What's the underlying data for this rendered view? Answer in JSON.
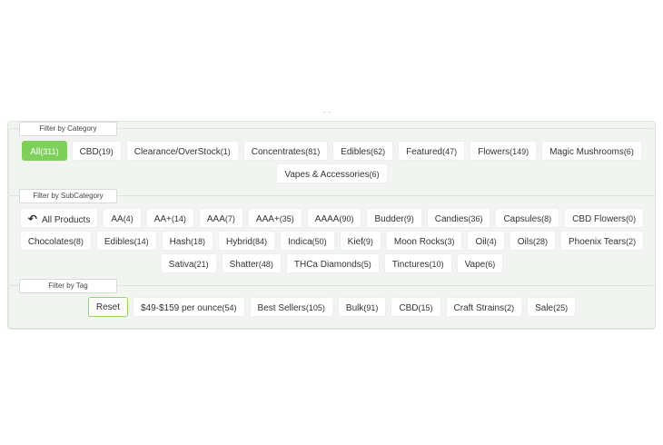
{
  "category": {
    "legend": "Filter by Category",
    "rows": [
      [
        {
          "label": "All",
          "count": "(311)",
          "active": true
        },
        {
          "label": "CBD",
          "count": "(19)"
        },
        {
          "label": "Clearance/OverStock",
          "count": "(1)"
        },
        {
          "label": "Concentrates",
          "count": "(81)"
        },
        {
          "label": "Edibles",
          "count": "(62)"
        },
        {
          "label": "Featured",
          "count": "(47)"
        },
        {
          "label": "Flowers",
          "count": "(149)"
        },
        {
          "label": "Magic Mushrooms",
          "count": "(6)"
        }
      ],
      [
        {
          "label": "Vapes & Accessories",
          "count": "(6)"
        }
      ]
    ]
  },
  "subcategory": {
    "legend": "Filter by SubCategory",
    "all_products_label": "All Products",
    "rows": [
      [
        {
          "label": "AA",
          "count": "(4)"
        },
        {
          "label": "AA+",
          "count": "(14)"
        },
        {
          "label": "AAA",
          "count": "(7)"
        },
        {
          "label": "AAA+",
          "count": "(35)"
        },
        {
          "label": "AAAA",
          "count": "(90)"
        },
        {
          "label": "Budder",
          "count": "(9)"
        },
        {
          "label": "Candies",
          "count": "(36)"
        },
        {
          "label": "Capsules",
          "count": "(8)"
        },
        {
          "label": "CBD Flowers",
          "count": "(0)"
        }
      ],
      [
        {
          "label": "Chocolates",
          "count": "(8)"
        },
        {
          "label": "Edibles",
          "count": "(14)"
        },
        {
          "label": "Hash",
          "count": "(18)"
        },
        {
          "label": "Hybrid",
          "count": "(84)"
        },
        {
          "label": "Indica",
          "count": "(50)"
        },
        {
          "label": "Kief",
          "count": "(9)"
        },
        {
          "label": "Moon Rocks",
          "count": "(3)"
        },
        {
          "label": "Oil",
          "count": "(4)"
        },
        {
          "label": "Oils",
          "count": "(28)"
        },
        {
          "label": "Phoenix Tears",
          "count": "(2)"
        }
      ],
      [
        {
          "label": "Sativa",
          "count": "(21)"
        },
        {
          "label": "Shatter",
          "count": "(48)"
        },
        {
          "label": "THCa Diamonds",
          "count": "(5)"
        },
        {
          "label": "Tinctures",
          "count": "(10)"
        },
        {
          "label": "Vape",
          "count": "(6)"
        }
      ]
    ]
  },
  "tag": {
    "legend": "Filter by Tag",
    "reset_label": "Reset",
    "rows": [
      [
        {
          "label": "$49-$159 per ounce",
          "count": "(54)"
        },
        {
          "label": "Best Sellers",
          "count": "(105)"
        },
        {
          "label": "Bulk",
          "count": "(91)"
        },
        {
          "label": "CBD",
          "count": "(15)"
        },
        {
          "label": "Craft Strains",
          "count": "(2)"
        },
        {
          "label": "Sale",
          "count": "(25)"
        }
      ]
    ]
  },
  "colors": {
    "accent": "#7ed05a",
    "panel_bg": "#f1f4f1"
  },
  "icons": {
    "back": "undo-arrow-icon"
  }
}
